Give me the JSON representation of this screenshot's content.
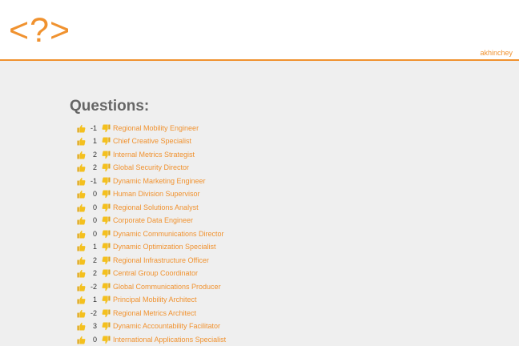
{
  "header": {
    "logo_text": "<?>",
    "username": "akhinchey"
  },
  "main": {
    "title": "Questions:",
    "questions": [
      {
        "score": "-1",
        "title": "Regional Mobility Engineer"
      },
      {
        "score": "1",
        "title": "Chief Creative Specialist"
      },
      {
        "score": "2",
        "title": "Internal Metrics Strategist"
      },
      {
        "score": "2",
        "title": "Global Security Director"
      },
      {
        "score": "-1",
        "title": "Dynamic Marketing Engineer"
      },
      {
        "score": "0",
        "title": "Human Division Supervisor"
      },
      {
        "score": "0",
        "title": "Regional Solutions Analyst"
      },
      {
        "score": "0",
        "title": "Corporate Data Engineer"
      },
      {
        "score": "0",
        "title": "Dynamic Communications Director"
      },
      {
        "score": "1",
        "title": "Dynamic Optimization Specialist"
      },
      {
        "score": "2",
        "title": "Regional Infrastructure Officer"
      },
      {
        "score": "2",
        "title": "Central Group Coordinator"
      },
      {
        "score": "-2",
        "title": "Global Communications Producer"
      },
      {
        "score": "1",
        "title": "Principal Mobility Architect"
      },
      {
        "score": "-2",
        "title": "Regional Metrics Architect"
      },
      {
        "score": "3",
        "title": "Dynamic Accountability Facilitator"
      },
      {
        "score": "0",
        "title": "International Applications Specialist"
      }
    ]
  },
  "icons": {
    "upvote": "thumbs-up-icon",
    "downvote": "thumbs-down-icon"
  },
  "colors": {
    "accent": "#f0922f",
    "thumb": "#f4c01e",
    "background": "#efefef",
    "title": "#666666"
  }
}
